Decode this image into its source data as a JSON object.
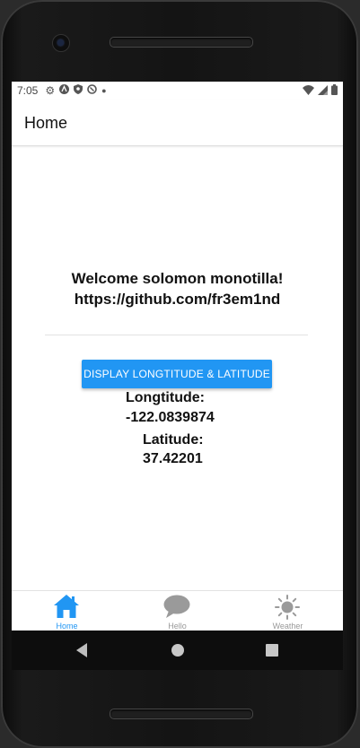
{
  "status_bar": {
    "time": "7:05",
    "left_icons": [
      "settings-icon",
      "app-icon",
      "shield-icon",
      "sync-icon",
      "dot-icon"
    ],
    "right_icons": [
      "wifi-icon",
      "signal-icon",
      "battery-icon"
    ]
  },
  "app_bar": {
    "title": "Home"
  },
  "main": {
    "welcome_line1": "Welcome solomon monotilla!",
    "welcome_line2": "https://github.com/fr3em1nd",
    "button_label": "DISPLAY LONGTITUDE & LATITUDE",
    "longitude_label": "Longtitude:",
    "longitude_value": "-122.0839874",
    "latitude_label": "Latitude:",
    "latitude_value": "37.42201"
  },
  "tabs": [
    {
      "label": "Home",
      "icon": "home-icon",
      "active": true
    },
    {
      "label": "Hello",
      "icon": "chat-bubble-icon",
      "active": false
    },
    {
      "label": "Weather",
      "icon": "sun-icon",
      "active": false
    }
  ],
  "colors": {
    "accent": "#2196f3",
    "inactive_tab": "#999999"
  }
}
